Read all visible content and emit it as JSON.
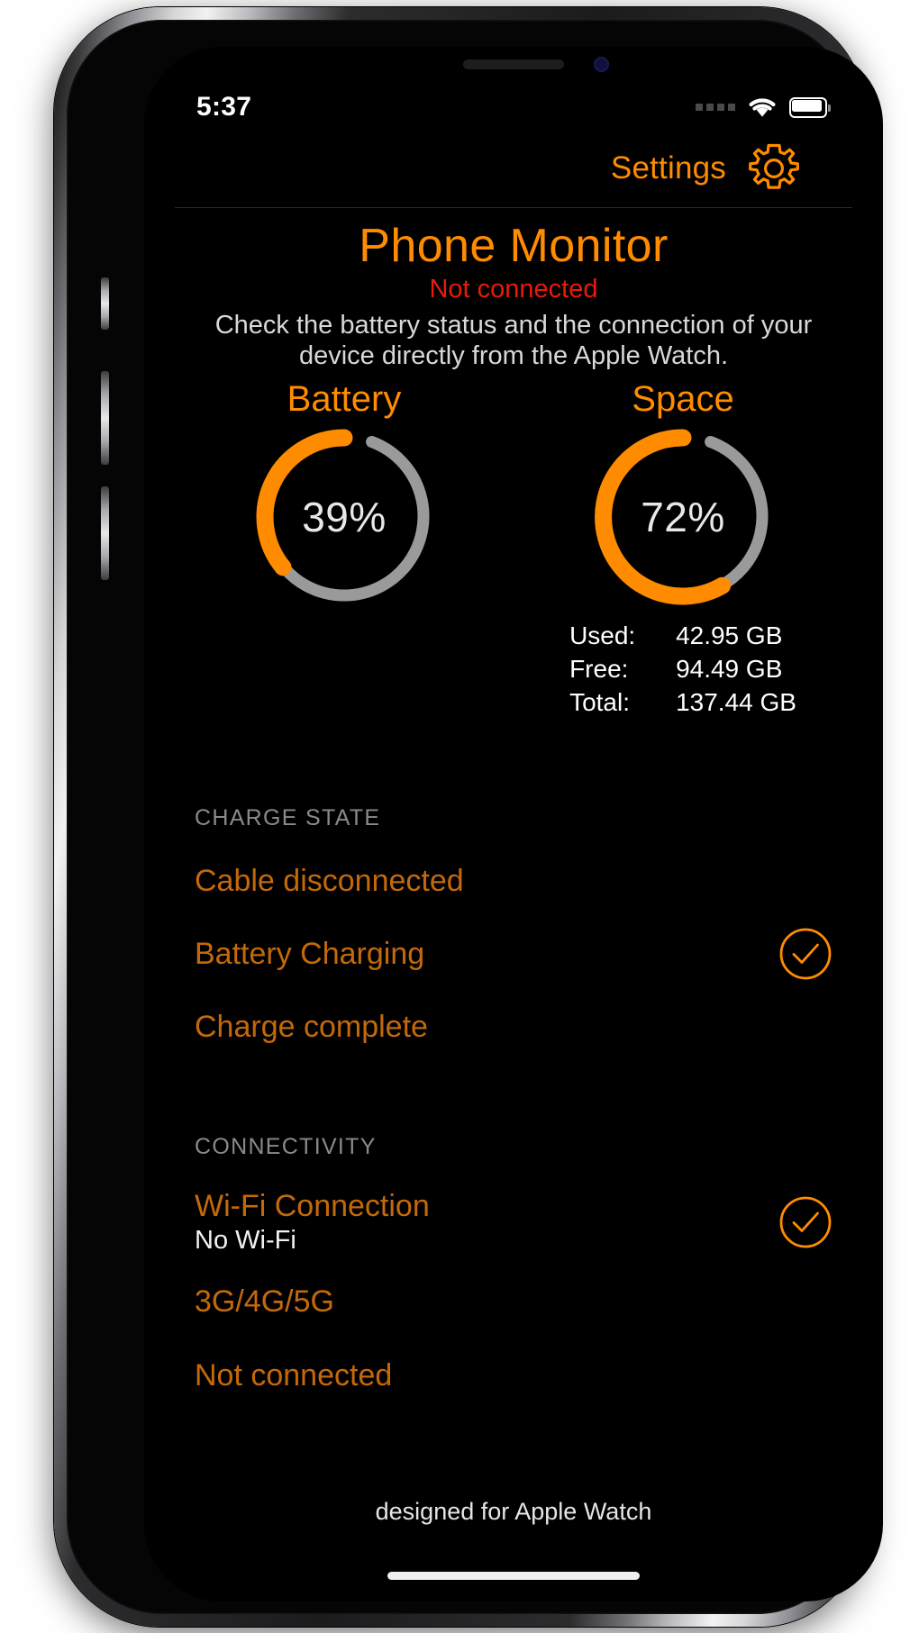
{
  "statusbar": {
    "time": "5:37",
    "signal_icon": "signal-dots-icon",
    "wifi_icon": "wifi-icon",
    "battery_icon": "battery-icon"
  },
  "navbar": {
    "settings_label": "Settings",
    "gear_icon": "gear-icon"
  },
  "header": {
    "title": "Phone Monitor",
    "connection_status": "Not connected",
    "description": "Check the battery status and the connection of your device directly from the Apple Watch."
  },
  "gauges": [
    {
      "name": "battery",
      "title": "Battery",
      "value_label": "39%",
      "percent": 39
    },
    {
      "name": "space",
      "title": "Space",
      "value_label": "72%",
      "percent": 72
    }
  ],
  "storage": {
    "rows": [
      {
        "label": "Used:",
        "value": "42.95 GB"
      },
      {
        "label": "Free:",
        "value": "94.49 GB"
      },
      {
        "label": "Total:",
        "value": "137.44 GB"
      }
    ]
  },
  "charge_state": {
    "header": "CHARGE STATE",
    "items": [
      {
        "label": "Cable disconnected",
        "checked": false
      },
      {
        "label": "Battery Charging",
        "checked": true
      },
      {
        "label": "Charge complete",
        "checked": false
      }
    ]
  },
  "connectivity": {
    "header": "CONNECTIVITY",
    "items": [
      {
        "label": "Wi-Fi Connection",
        "sub": "No Wi-Fi",
        "checked": true
      },
      {
        "label": "3G/4G/5G",
        "sub": "",
        "checked": false
      },
      {
        "label": "Not connected",
        "sub": "",
        "checked": false
      }
    ]
  },
  "footer": {
    "text": "designed for Apple Watch"
  },
  "colors": {
    "accent_orange": "#FF8C00",
    "label_orange": "#C4690A",
    "error_red": "#E81B0A",
    "track_gray": "#9a9a9a",
    "section_gray": "#8a8a8a",
    "background": "#000000"
  }
}
